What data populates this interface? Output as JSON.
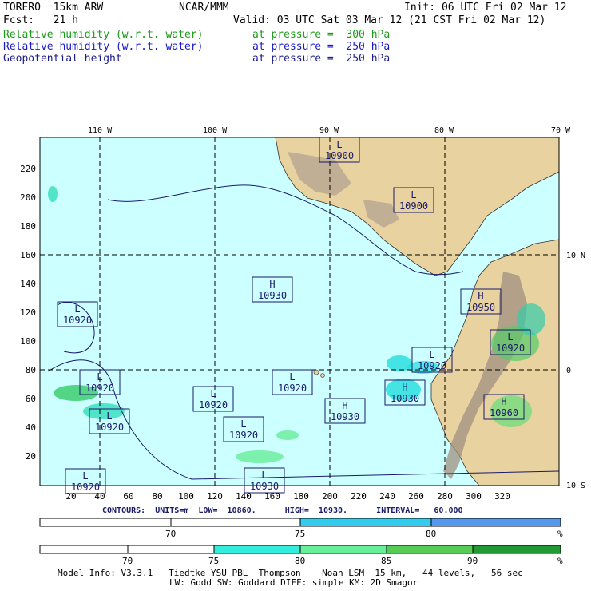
{
  "header": {
    "model": "TORERO  15km ARW",
    "org": "NCAR/MMM",
    "init": "Init: 06 UTC Fri 02 Mar 12",
    "fcst": "Fcst:   21 h",
    "valid": "Valid: 03 UTC Sat 03 Mar 12 (21 CST Fri 02 Mar 12)"
  },
  "fields": [
    {
      "name": "Relative humidity (w.r.t. water)",
      "level": "at pressure =  300 hPa",
      "color": "#1a9a1a"
    },
    {
      "name": "Relative humidity (w.r.t. water)",
      "level": "at pressure =  250 hPa",
      "color": "#1a1acc"
    },
    {
      "name": "Geopotential height",
      "level": "at pressure =  250 hPa",
      "color": "#1a1a8a"
    }
  ],
  "map": {
    "top_lon_labels": [
      "110 W",
      "100 W",
      "90 W",
      "80 W",
      "70 W"
    ],
    "right_lat_labels": [
      "10 N",
      "0",
      "10 S"
    ],
    "y_ticks": [
      "20",
      "40",
      "60",
      "80",
      "100",
      "120",
      "140",
      "160",
      "180",
      "200",
      "220"
    ],
    "x_ticks": [
      "20",
      "40",
      "60",
      "80",
      "100",
      "120",
      "140",
      "160",
      "180",
      "200",
      "220",
      "240",
      "260",
      "280",
      "300",
      "320"
    ],
    "highs_lows": [
      {
        "type": "L",
        "value": "10900"
      },
      {
        "type": "L",
        "value": "10900"
      },
      {
        "type": "H",
        "value": "10930"
      },
      {
        "type": "H",
        "value": "10950"
      },
      {
        "type": "L",
        "value": "10920"
      },
      {
        "type": "L",
        "value": "10920"
      },
      {
        "type": "L",
        "value": "10920"
      },
      {
        "type": "L",
        "value": "10920"
      },
      {
        "type": "L",
        "value": "10920"
      },
      {
        "type": "L",
        "value": "10920"
      },
      {
        "type": "L",
        "value": "10920"
      },
      {
        "type": "L",
        "value": "10920"
      },
      {
        "type": "H",
        "value": "10930"
      },
      {
        "type": "H",
        "value": "10930"
      },
      {
        "type": "H",
        "value": "10960"
      },
      {
        "type": "L",
        "value": "10920"
      },
      {
        "type": "L",
        "value": "10930"
      },
      {
        "type": "L",
        "value": "10920"
      }
    ],
    "colors": {
      "ocean": "#ccffff",
      "land": "#e8d2a0",
      "mountain": "#b0a090",
      "grid": "#000000",
      "contour": "#1a1a6a"
    }
  },
  "contours_info": "CONTOURS:  UNITS=m  LOW=  10860.      HIGH=  10930.      INTERVAL=   60.000",
  "bar1": {
    "labels": [
      "70",
      "75",
      "80"
    ],
    "pct": "%"
  },
  "bar2": {
    "labels": [
      "70",
      "75",
      "80",
      "85",
      "90"
    ],
    "pct": "%"
  },
  "footer": {
    "line1": "Model Info: V3.3.1   Tiedtke YSU PBL  Thompson    Noah LSM  15 km,   44 levels,   56 sec",
    "line2": "LW: Godd SW: Goddard DIFF: simple KM: 2D Smagor"
  }
}
